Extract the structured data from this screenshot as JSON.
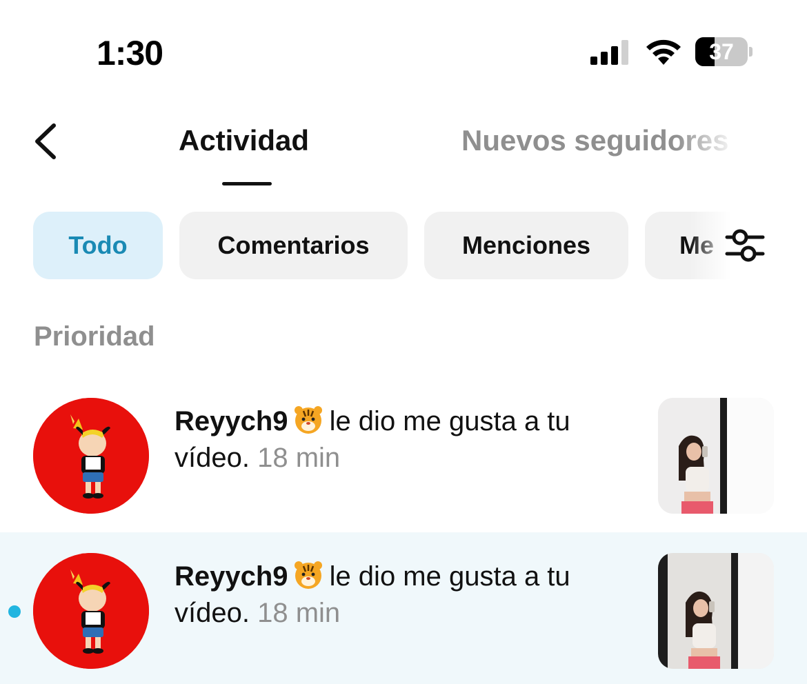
{
  "status_bar": {
    "time": "1:30",
    "battery_level": "37",
    "battery_fraction": 0.37,
    "signal_icon": "cellular-signal-icon",
    "wifi_icon": "wifi-icon"
  },
  "header": {
    "back_icon": "chevron-left-icon",
    "tabs": [
      {
        "label": "Actividad",
        "active": true
      },
      {
        "label": "Nuevos seguidores",
        "active": false
      }
    ]
  },
  "filters": {
    "chips": [
      {
        "label": "Todo",
        "active": true
      },
      {
        "label": "Comentarios",
        "active": false
      },
      {
        "label": "Menciones",
        "active": false
      },
      {
        "label": "Me",
        "active": false
      }
    ],
    "filter_icon": "sliders-icon"
  },
  "section": {
    "title": "Prioridad"
  },
  "activities": [
    {
      "username": "Reyych9",
      "emoji_icon": "tiger-face-emoji-icon",
      "action": "le dio me gusta a tu vídeo.",
      "time": "18 min",
      "unread": false
    },
    {
      "username": "Reyych9",
      "emoji_icon": "tiger-face-emoji-icon",
      "action": "le dio me gusta a tu vídeo.",
      "time": "18 min",
      "unread": true
    }
  ],
  "colors": {
    "accent": "#1a8ab4",
    "accent_bg": "#ddf0fa",
    "unread_bg": "#f0f8fb",
    "unread_dot": "#22b5e0",
    "avatar_bg": "#e8100c",
    "muted_text": "#8f8f8f"
  }
}
